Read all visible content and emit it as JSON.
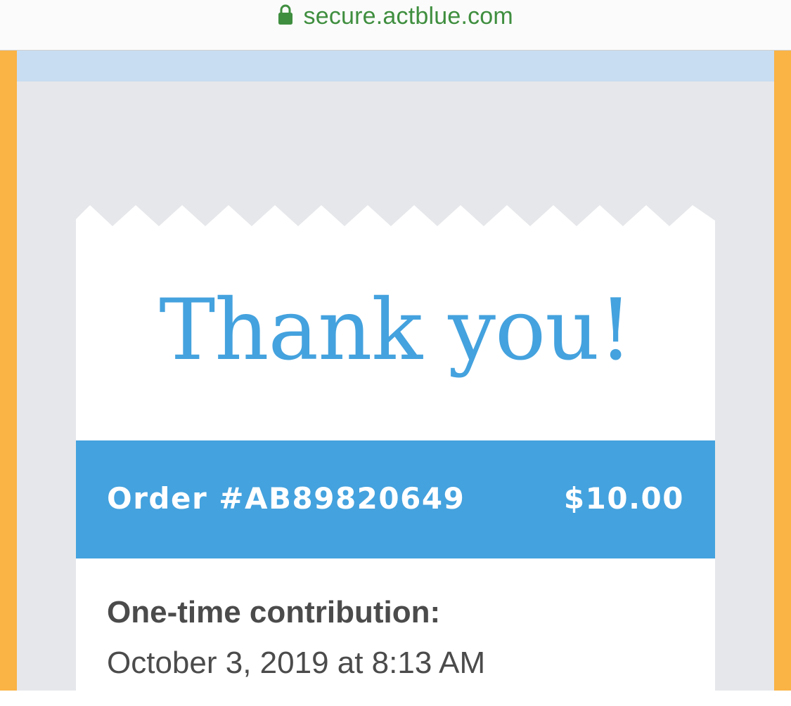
{
  "browser": {
    "url": "secure.actblue.com",
    "lock_icon": "lock-icon",
    "url_color": "#3f8e3f"
  },
  "receipt": {
    "headline": "Thank you!",
    "order_label": "Order #AB89820649",
    "amount": "$10.00",
    "contribution_type": "One-time contribution:",
    "contribution_date": "October 3, 2019 at 8:13 AM"
  },
  "colors": {
    "accent": "#44a2de",
    "frame": "#fab345",
    "background": "#e6e7ea",
    "top_band": "#c8ddf1"
  }
}
